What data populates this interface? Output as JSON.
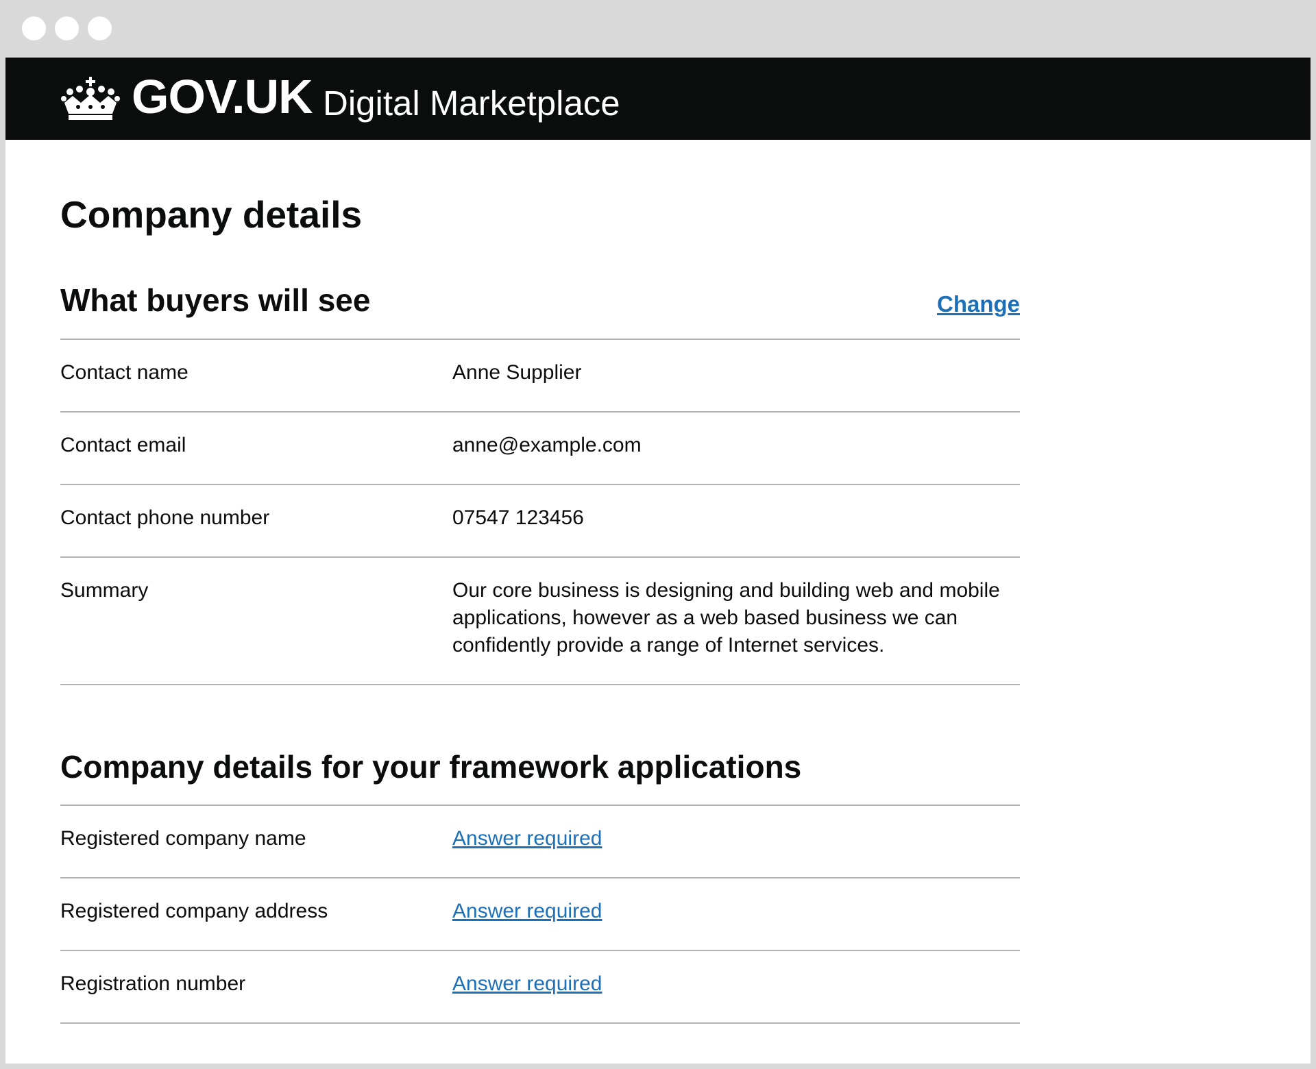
{
  "header": {
    "logo_text": "GOV.UK",
    "service_name": "Digital Marketplace"
  },
  "page_title": "Company details",
  "buyers_section": {
    "heading": "What buyers will see",
    "change_link": "Change",
    "rows": [
      {
        "key": "Contact name",
        "value": "Anne Supplier"
      },
      {
        "key": "Contact email",
        "value": "anne@example.com"
      },
      {
        "key": "Contact phone number",
        "value": "07547 123456"
      },
      {
        "key": "Summary",
        "value": "Our core business is designing and building web and mobile applications, however as a web based business we can confidently provide a range of Internet services."
      }
    ]
  },
  "framework_section": {
    "heading": "Company details for your framework applications",
    "rows": [
      {
        "key": "Registered company name",
        "value": "Answer required"
      },
      {
        "key": "Registered company address",
        "value": "Answer required"
      },
      {
        "key": "Registration number",
        "value": "Answer required"
      }
    ]
  },
  "colors": {
    "header_bg": "#0b0c0c",
    "link": "#1d70b8",
    "divider": "#b1b4b6",
    "window_frame": "#d9d9d9"
  }
}
